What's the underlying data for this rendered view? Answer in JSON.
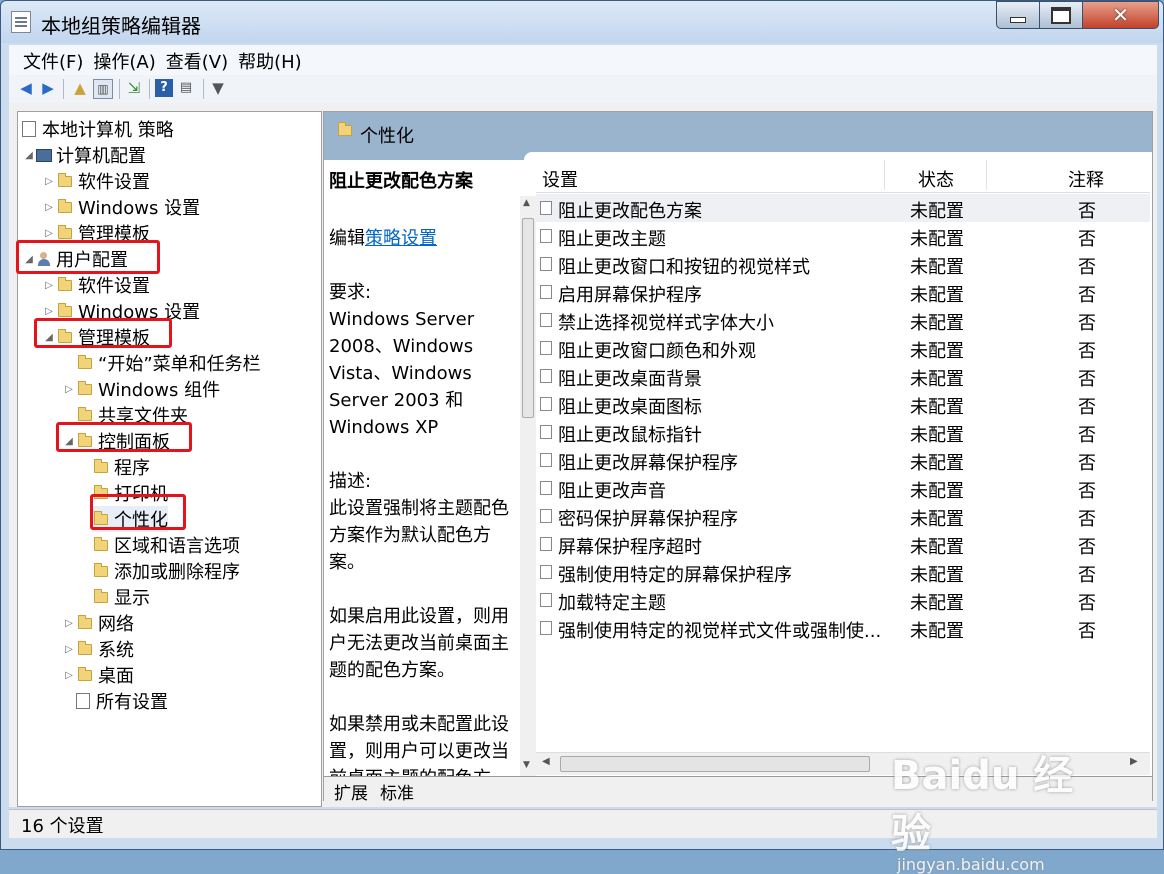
{
  "window": {
    "title": "本地组策略编辑器"
  },
  "menu": [
    "文件(F)",
    "操作(A)",
    "查看(V)",
    "帮助(H)"
  ],
  "tree": {
    "root": "本地计算机 策略",
    "computer_config": "计算机配置",
    "computer_software": "软件设置",
    "computer_windows": "Windows 设置",
    "computer_admin": "管理模板",
    "user_config": "用户配置",
    "user_software": "软件设置",
    "user_windows": "Windows 设置",
    "user_admin": "管理模板",
    "start_menu": "“开始”菜单和任务栏",
    "windows_components": "Windows 组件",
    "shared_folders": "共享文件夹",
    "control_panel": "控制面板",
    "programs": "程序",
    "printers": "打印机",
    "personalization": "个性化",
    "region_language": "区域和语言选项",
    "add_remove": "添加或删除程序",
    "display": "显示",
    "network": "网络",
    "system": "系统",
    "desktop": "桌面",
    "all_settings": "所有设置"
  },
  "panel": {
    "header_title": "个性化",
    "desc": {
      "title": "阻止更改配色方案",
      "edit_prefix": "编辑",
      "edit_link": "策略设置",
      "req_label": "要求:",
      "req_lines": [
        "Windows Server",
        "2008、Windows",
        "Vista、Windows",
        "Server 2003 和",
        "Windows XP"
      ],
      "desc_label": "描述:",
      "desc_lines": [
        "此设置强制将主题配色",
        "方案作为默认配色方",
        "案。"
      ],
      "p2_lines": [
        "如果启用此设置，则用",
        "户无法更改当前桌面主",
        "题的配色方案。"
      ],
      "p3_lines": [
        "如果禁用或未配置此设",
        "置，则用户可以更改当",
        "前桌面主题的配色方"
      ]
    },
    "columns": {
      "setting": "设置",
      "state": "状态",
      "comment": "注释"
    },
    "rows": [
      {
        "name": "阻止更改配色方案",
        "state": "未配置",
        "comment": "否"
      },
      {
        "name": "阻止更改主题",
        "state": "未配置",
        "comment": "否"
      },
      {
        "name": "阻止更改窗口和按钮的视觉样式",
        "state": "未配置",
        "comment": "否"
      },
      {
        "name": "启用屏幕保护程序",
        "state": "未配置",
        "comment": "否"
      },
      {
        "name": "禁止选择视觉样式字体大小",
        "state": "未配置",
        "comment": "否"
      },
      {
        "name": "阻止更改窗口颜色和外观",
        "state": "未配置",
        "comment": "否"
      },
      {
        "name": "阻止更改桌面背景",
        "state": "未配置",
        "comment": "否"
      },
      {
        "name": "阻止更改桌面图标",
        "state": "未配置",
        "comment": "否"
      },
      {
        "name": "阻止更改鼠标指针",
        "state": "未配置",
        "comment": "否"
      },
      {
        "name": "阻止更改屏幕保护程序",
        "state": "未配置",
        "comment": "否"
      },
      {
        "name": "阻止更改声音",
        "state": "未配置",
        "comment": "否"
      },
      {
        "name": "密码保护屏幕保护程序",
        "state": "未配置",
        "comment": "否"
      },
      {
        "name": "屏幕保护程序超时",
        "state": "未配置",
        "comment": "否"
      },
      {
        "name": "强制使用特定的屏幕保护程序",
        "state": "未配置",
        "comment": "否"
      },
      {
        "name": "加载特定主题",
        "state": "未配置",
        "comment": "否"
      },
      {
        "name": "强制使用特定的视觉样式文件或强制使...",
        "state": "未配置",
        "comment": "否"
      }
    ],
    "tabs": [
      "扩展",
      "标准"
    ]
  },
  "status": "16 个设置",
  "watermark": {
    "logo": "Baidu 经验",
    "sub": "jingyan.baidu.com"
  },
  "colors": {
    "highlight": "#e5141c",
    "header": "#9bb4ce",
    "link": "#0066cc"
  }
}
